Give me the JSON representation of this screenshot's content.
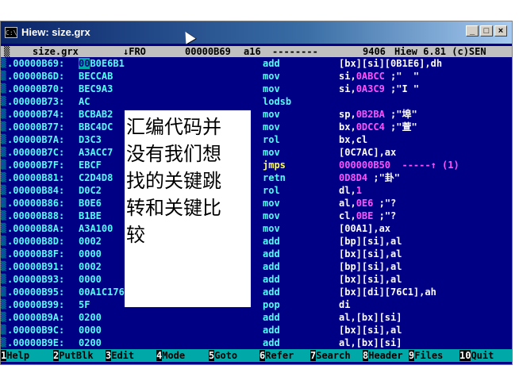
{
  "window": {
    "title": "Hiew: size.grx",
    "sys_icon": "C:\\",
    "buttons": {
      "minimize": "_",
      "maximize": "□",
      "close": "×"
    }
  },
  "status": {
    "file": "size.grx",
    "mode": "↓FRO",
    "offset": "00000B69",
    "bits": "a16",
    "dashes": "--------",
    "size": "9406",
    "version": "Hiew 6.81 (c)SEN"
  },
  "lines": [
    {
      "addr": ".00000B69:",
      "hex_cur": "00",
      "hex": "B0E6B1",
      "mnem": "add",
      "op": [
        {
          "t": "[bx][si][0B1E6],dh",
          "c": "txt"
        }
      ]
    },
    {
      "addr": ".00000B6D:",
      "hex": "BECCAB",
      "mnem": "mov",
      "op": [
        {
          "t": "si,",
          "c": "txt"
        },
        {
          "t": "0ABCC",
          "c": "num"
        },
        {
          "t": " ;\"  \"",
          "c": "cmt"
        }
      ]
    },
    {
      "addr": ".00000B70:",
      "hex": "BEC9A3",
      "mnem": "mov",
      "op": [
        {
          "t": "si,",
          "c": "txt"
        },
        {
          "t": "0A3C9",
          "c": "num"
        },
        {
          "t": " ;\"Ι \"",
          "c": "cmt"
        }
      ]
    },
    {
      "addr": ".00000B73:",
      "hex": "AC",
      "mnem": "lodsb",
      "op": []
    },
    {
      "addr": ".00000B74:",
      "hex": "BCBAB2",
      "mnem": "mov",
      "op": [
        {
          "t": "sp,",
          "c": "txt"
        },
        {
          "t": "0B2BA",
          "c": "num"
        },
        {
          "t": " ;\"埠\"",
          "c": "cmt"
        }
      ]
    },
    {
      "addr": ".00000B77:",
      "hex": "BBC4DC",
      "mnem": "mov",
      "op": [
        {
          "t": "bx,",
          "c": "txt"
        },
        {
          "t": "0DCC4",
          "c": "num"
        },
        {
          "t": " ;\"萱\"",
          "c": "cmt"
        }
      ]
    },
    {
      "addr": ".00000B7A:",
      "hex": "D3C3",
      "mnem": "rol",
      "op": [
        {
          "t": "bx,cl",
          "c": "txt"
        }
      ]
    },
    {
      "addr": ".00000B7C:",
      "hex": "A3ACC7",
      "mnem": "mov",
      "op": [
        {
          "t": "[0C7AC],ax",
          "c": "txt"
        }
      ]
    },
    {
      "addr": ".00000B7F:",
      "hex": "EBCF",
      "mnem": "jmps",
      "jmp": true,
      "op": [
        {
          "t": "000000B50",
          "c": "tgt"
        },
        {
          "t": "  -----↑ (1)",
          "c": "arr"
        }
      ]
    },
    {
      "addr": ".00000B81:",
      "hex": "C2D4D8",
      "mnem": "retn",
      "op": [
        {
          "t": "0D8D4",
          "c": "num"
        },
        {
          "t": " ;\"卦\"",
          "c": "cmt"
        }
      ]
    },
    {
      "addr": ".00000B84:",
      "hex": "D0C2",
      "mnem": "rol",
      "op": [
        {
          "t": "dl,",
          "c": "txt"
        },
        {
          "t": "1",
          "c": "num"
        }
      ]
    },
    {
      "addr": ".00000B86:",
      "hex": "B0E6",
      "mnem": "mov",
      "op": [
        {
          "t": "al,",
          "c": "txt"
        },
        {
          "t": "0E6",
          "c": "num"
        },
        {
          "t": " ;\"?",
          "c": "cmt"
        }
      ]
    },
    {
      "addr": ".00000B88:",
      "hex": "B1BE",
      "mnem": "mov",
      "op": [
        {
          "t": "cl,",
          "c": "txt"
        },
        {
          "t": "0BE",
          "c": "num"
        },
        {
          "t": " ;\"?",
          "c": "cmt"
        }
      ]
    },
    {
      "addr": ".00000B8A:",
      "hex": "A3A100",
      "mnem": "mov",
      "op": [
        {
          "t": "[00A1],ax",
          "c": "txt"
        }
      ]
    },
    {
      "addr": ".00000B8D:",
      "hex": "0002",
      "mnem": "add",
      "op": [
        {
          "t": "[bp][si],al",
          "c": "txt"
        }
      ]
    },
    {
      "addr": ".00000B8F:",
      "hex": "0000",
      "mnem": "add",
      "op": [
        {
          "t": "[bx][si],al",
          "c": "txt"
        }
      ]
    },
    {
      "addr": ".00000B91:",
      "hex": "0002",
      "mnem": "add",
      "op": [
        {
          "t": "[bp][si],al",
          "c": "txt"
        }
      ]
    },
    {
      "addr": ".00000B93:",
      "hex": "0000",
      "mnem": "add",
      "op": [
        {
          "t": "[bx][si],al",
          "c": "txt"
        }
      ]
    },
    {
      "addr": ".00000B95:",
      "hex": "00A1C176",
      "mnem": "add",
      "op": [
        {
          "t": "[bx][di][76C1],ah",
          "c": "txt"
        }
      ]
    },
    {
      "addr": ".00000B99:",
      "hex": "5F",
      "mnem": "pop",
      "op": [
        {
          "t": "di",
          "c": "txt"
        }
      ]
    },
    {
      "addr": ".00000B9A:",
      "hex": "0200",
      "mnem": "add",
      "op": [
        {
          "t": "al,[bx][si]",
          "c": "txt"
        }
      ]
    },
    {
      "addr": ".00000B9C:",
      "hex": "0000",
      "mnem": "add",
      "op": [
        {
          "t": "[bx][si],al",
          "c": "txt"
        }
      ]
    },
    {
      "addr": ".00000B9E:",
      "hex": "0200",
      "mnem": "add",
      "op": [
        {
          "t": "al,[bx][si]",
          "c": "txt"
        }
      ]
    }
  ],
  "overlay_lines": [
    "汇编代码并",
    "没有我们想",
    "找的关键跳",
    "转和关键比",
    "较"
  ],
  "fkeys": [
    {
      "n": "1",
      "label": "Help"
    },
    {
      "n": "2",
      "label": "PutBlk"
    },
    {
      "n": "3",
      "label": "Edit"
    },
    {
      "n": "4",
      "label": "Mode"
    },
    {
      "n": "5",
      "label": "Goto"
    },
    {
      "n": "6",
      "label": "Refer"
    },
    {
      "n": "7",
      "label": "Search"
    },
    {
      "n": "8",
      "label": "Header"
    },
    {
      "n": "9",
      "label": "Files"
    },
    {
      "n": "10",
      "label": "Quit"
    }
  ],
  "colors": {
    "background": "#000084",
    "text": "#54fcfc",
    "accent": "#fc54fc",
    "statusbar": "#c0c0c0",
    "fkeybar": "#00a8a8"
  }
}
